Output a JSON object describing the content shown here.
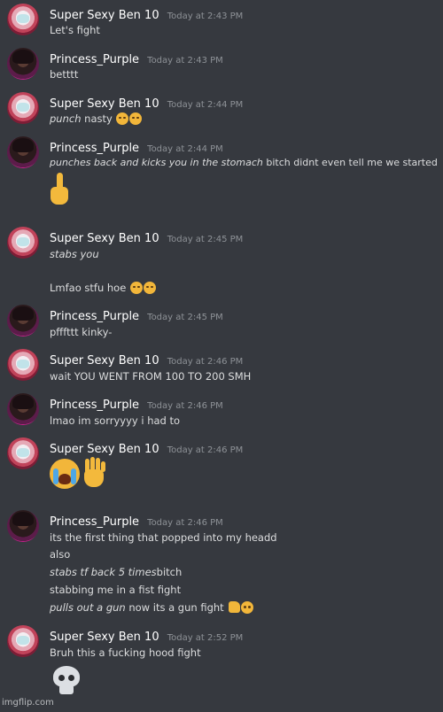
{
  "users": {
    "ben": "Super Sexy Ben 10",
    "pp": "Princess_Purple"
  },
  "messages": [
    {
      "user": "Super Sexy Ben 10",
      "time": "Today at 2:43 PM",
      "lines": [
        "Let's fight"
      ]
    },
    {
      "user": "Princess_Purple",
      "time": "Today at 2:43 PM",
      "lines": [
        "betttt"
      ]
    },
    {
      "user": "Super Sexy Ben 10",
      "time": "Today at 2:44 PM",
      "lines": [
        {
          "italic": "punch",
          "text": " nasty"
        }
      ],
      "emoji": [
        "unamused-face-icon",
        "unamused-face-icon"
      ]
    },
    {
      "user": "Princess_Purple",
      "time": "Today at 2:44 PM",
      "lines": [
        {
          "italic": "punches back and kicks you in the stomach",
          "text": " bitch didnt even tell me we started"
        }
      ],
      "emoji": [
        "middle-finger-icon"
      ]
    },
    {
      "user": "Super Sexy Ben 10",
      "time": "Today at 2:45 PM",
      "lines": [
        {
          "italic": "stabs you",
          "text": ""
        },
        "Lmfao stfu hoe"
      ],
      "emoji": [
        "eye-roll-face-icon",
        "eye-roll-face-icon"
      ]
    },
    {
      "user": "Princess_Purple",
      "time": "Today at 2:45 PM",
      "lines": [
        "pfffttt kinky-"
      ]
    },
    {
      "user": "Super Sexy Ben 10",
      "time": "Today at 2:46 PM",
      "lines": [
        "wait YOU WENT FROM 100 TO 200 SMH"
      ]
    },
    {
      "user": "Princess_Purple",
      "time": "Today at 2:46 PM",
      "lines": [
        "lmao im sorryyyy i had to"
      ]
    },
    {
      "user": "Super Sexy Ben 10",
      "time": "Today at 2:46 PM",
      "lines": [],
      "emoji": [
        "loudly-crying-face-icon",
        "raised-hand-icon"
      ]
    },
    {
      "user": "Princess_Purple",
      "time": "Today at 2:46 PM",
      "lines": [
        "its the first thing that popped into my headd",
        "also",
        {
          "italic": "stabs tf back 5 times",
          "text": "bitch"
        },
        "stabbing me in a fist fight",
        {
          "italic": "pulls out a gun",
          "text": " now its a gun fight"
        }
      ],
      "emoji": [
        "thumbs-up-icon",
        "relieved-face-icon"
      ]
    },
    {
      "user": "Super Sexy Ben 10",
      "time": "Today at 2:52 PM",
      "lines": [
        "Bruh this a fucking hood fight"
      ],
      "emoji": [
        "skull-icon"
      ]
    }
  ],
  "watermark": "imgflip.com",
  "colors": {
    "background": "#36393f",
    "username": "#ffffff",
    "timestamp": "#8e9297",
    "text": "#dcddde"
  }
}
